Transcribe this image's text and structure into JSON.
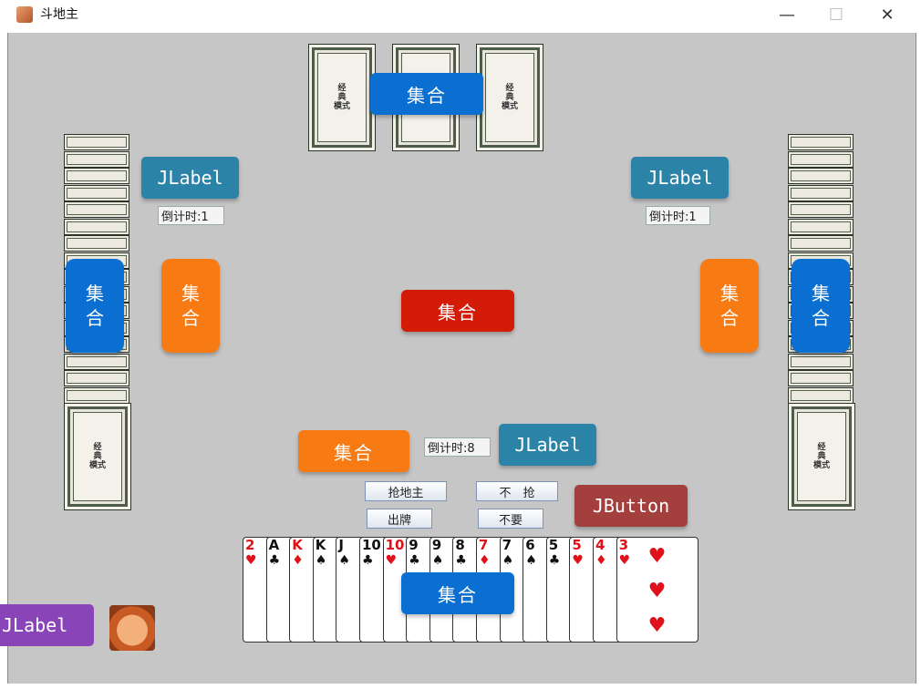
{
  "window": {
    "title": "斗地主",
    "controls": {
      "minimize": "—",
      "maximize": "☐",
      "close": "✕"
    }
  },
  "top": {
    "center_button": "集合"
  },
  "left_player": {
    "name_label": "JLabel",
    "countdown": "倒计时:1",
    "blue_button": "集\n合",
    "orange_button": "集\n合"
  },
  "right_player": {
    "name_label": "JLabel",
    "countdown": "倒计时:1",
    "blue_button": "集\n合",
    "orange_button": "集\n合"
  },
  "center": {
    "red_button": "集合"
  },
  "self": {
    "orange_button": "集合",
    "countdown": "倒计时:8",
    "name_label": "JLabel",
    "action_buttons": {
      "grab": "抢地主",
      "no_grab": "不　抢",
      "play": "出牌",
      "pass": "不要"
    },
    "jbutton": "JButton",
    "hand_button": "集合",
    "player_label": "JLabel"
  },
  "hand": [
    {
      "rank": "2",
      "suit": "♥",
      "color": "red"
    },
    {
      "rank": "A",
      "suit": "♣",
      "color": "black"
    },
    {
      "rank": "K",
      "suit": "♦",
      "color": "red"
    },
    {
      "rank": "K",
      "suit": "♠",
      "color": "black"
    },
    {
      "rank": "J",
      "suit": "♠",
      "color": "black"
    },
    {
      "rank": "10",
      "suit": "♣",
      "color": "black"
    },
    {
      "rank": "10",
      "suit": "♥",
      "color": "red"
    },
    {
      "rank": "9",
      "suit": "♣",
      "color": "black"
    },
    {
      "rank": "9",
      "suit": "♠",
      "color": "black"
    },
    {
      "rank": "8",
      "suit": "♣",
      "color": "black"
    },
    {
      "rank": "7",
      "suit": "♦",
      "color": "red"
    },
    {
      "rank": "7",
      "suit": "♠",
      "color": "black"
    },
    {
      "rank": "6",
      "suit": "♠",
      "color": "black"
    },
    {
      "rank": "5",
      "suit": "♣",
      "color": "black"
    },
    {
      "rank": "5",
      "suit": "♥",
      "color": "red"
    },
    {
      "rank": "4",
      "suit": "♦",
      "color": "red"
    },
    {
      "rank": "3",
      "suit": "♥",
      "color": "red"
    }
  ]
}
